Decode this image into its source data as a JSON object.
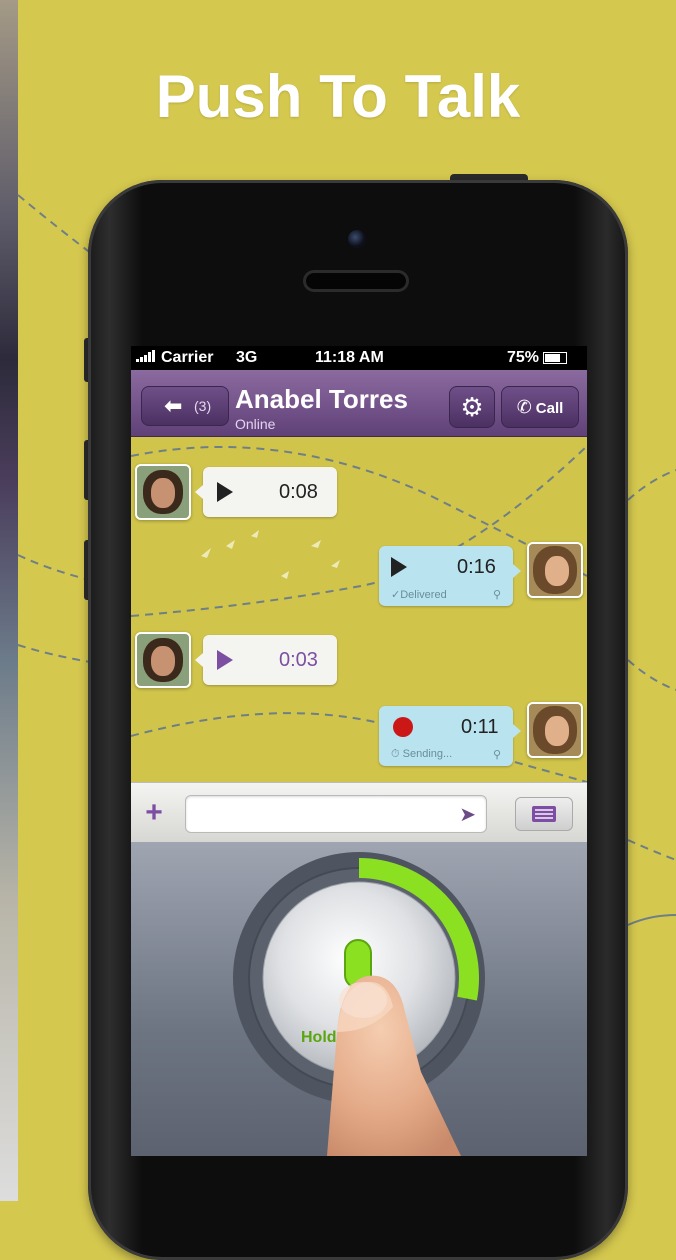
{
  "headline": "Push To Talk",
  "status_bar": {
    "carrier": "Carrier",
    "network": "3G",
    "time": "11:18 AM",
    "battery": "75%"
  },
  "nav": {
    "back_count": "(3)",
    "contact_name": "Anabel Torres",
    "contact_status": "Online",
    "call_label": "Call"
  },
  "messages": [
    {
      "direction": "in",
      "state": "play",
      "duration": "0:08"
    },
    {
      "direction": "out",
      "state": "play",
      "duration": "0:16",
      "meta": "✓Delivered"
    },
    {
      "direction": "in",
      "state": "playing",
      "duration": "0:03"
    },
    {
      "direction": "out",
      "state": "recording",
      "duration": "0:11",
      "meta": "⏱ Sending..."
    }
  ],
  "input": {
    "placeholder": ""
  },
  "ptt": {
    "button_label": "Hold",
    "progress_fraction": 0.28
  },
  "colors": {
    "background": "#d5c84f",
    "accent_purple": "#7d4fa3",
    "outgoing_bubble": "#b9e3ef",
    "progress_green": "#8be022"
  },
  "icons": [
    "back-arrow-icon",
    "gear-icon",
    "phone-icon",
    "play-icon",
    "record-icon",
    "location-pin-icon",
    "plus-icon",
    "send-arrow-icon",
    "keyboard-icon",
    "microphone-icon"
  ]
}
